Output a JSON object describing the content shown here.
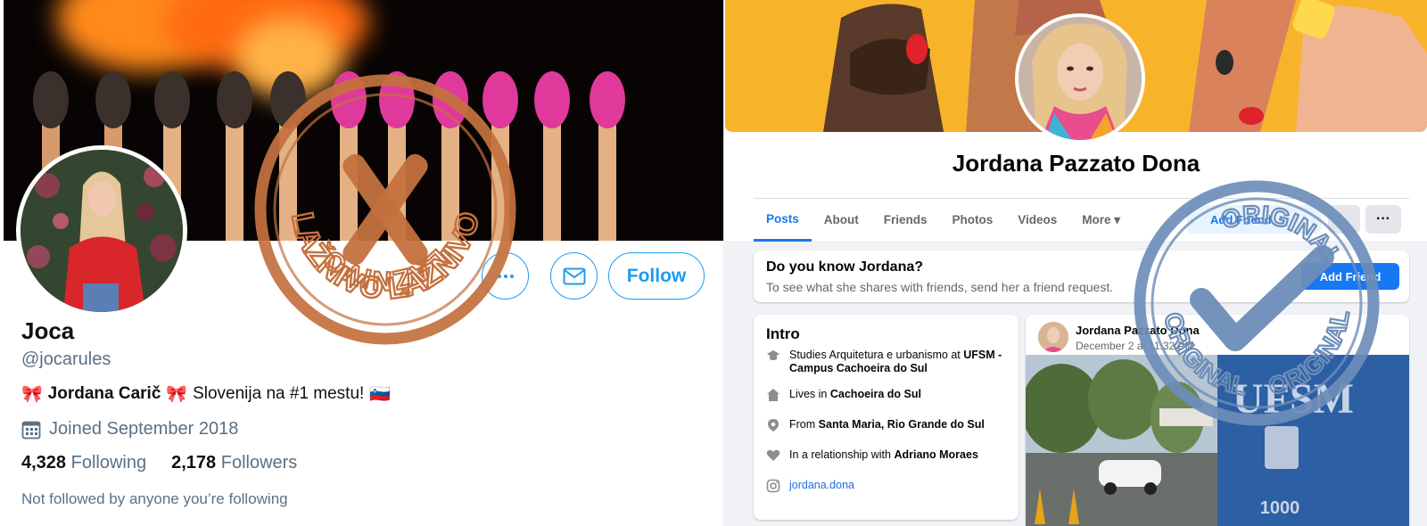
{
  "twitter": {
    "name": "Joca",
    "handle": "@jocarules",
    "bio": {
      "emoji_left": "🎀",
      "bold_name": "Jordana Carič",
      "emoji_mid": "🎀",
      "text": "Slovenija na #1 mestu!",
      "flag": "🇸🇮"
    },
    "joined": "Joined September 2018",
    "following_count": "4,328",
    "following_label": "Following",
    "followers_count": "2,178",
    "followers_label": "Followers",
    "not_followed": "Not followed by anyone you’re following",
    "follow_label": "Follow",
    "accent": "#1d9bf0",
    "icons": [
      "more-icon",
      "mail-icon",
      "calendar-icon"
    ]
  },
  "facebook": {
    "name": "Jordana Pazzato Dona",
    "tabs": [
      {
        "label": "Posts",
        "active": true
      },
      {
        "label": "About"
      },
      {
        "label": "Friends"
      },
      {
        "label": "Photos"
      },
      {
        "label": "Videos"
      },
      {
        "label": "More ▾"
      }
    ],
    "add_friend_label": "Add Friend",
    "more_button": "···",
    "know": {
      "title": "Do you know Jordana?",
      "subtitle": "To see what she shares with friends, send her a friend request.",
      "button": "Add Friend"
    },
    "intro": {
      "title": "Intro",
      "studies_pre": "Studies Arquitetura e urbanismo at",
      "studies_bold": "UFSM - Campus Cachoeira do Sul",
      "lives_pre": "Lives in",
      "lives_bold": "Cachoeira do Sul",
      "from_pre": "From",
      "from_bold": "Santa Maria, Rio Grande do Sul",
      "relationship_pre": "In a relationship with",
      "relationship_bold": "Adriano Moraes",
      "instagram": "jordana.dona"
    },
    "post": {
      "author": "Jordana Pazzato Dona",
      "date": "December 2 at 11:32 PM",
      "sign_text": "UFSM",
      "sign_number": "1000"
    },
    "accent": "#1877f2"
  },
  "stamps": {
    "fake": {
      "text": "LAŽNIVO",
      "color": "#c4713e"
    },
    "original": {
      "text": "ORIGINAL",
      "color": "#6d8db8"
    }
  }
}
